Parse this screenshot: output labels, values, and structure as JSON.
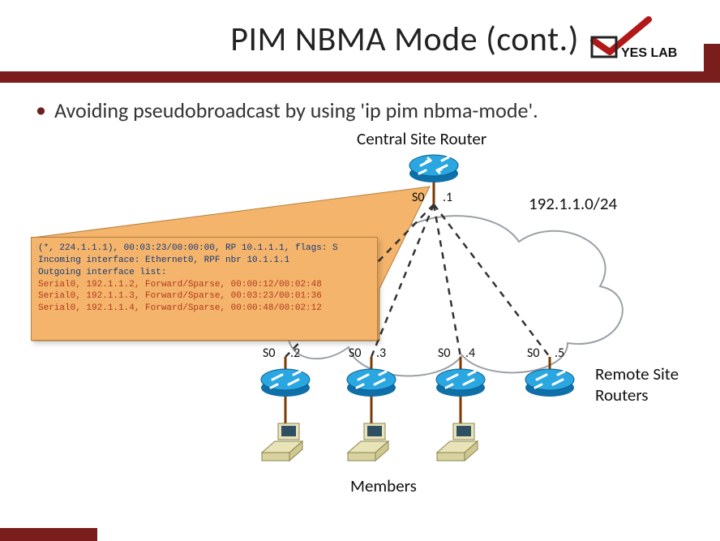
{
  "title": "PIM NBMA Mode (cont.)",
  "logo_text": "YES LAB",
  "bullet_text": "Avoiding pseudobroadcast by using 'ip pim nbma-mode'.",
  "labels": {
    "central_router": "Central Site Router",
    "subnet": "192.1.1.0/24",
    "remote_routers_l1": "Remote Site",
    "remote_routers_l2": "Routers",
    "members": "Members",
    "central_intf": "S0",
    "central_ip": ".1",
    "r2_intf": "S0",
    "r2_ip": ".2",
    "r3_intf": "S0",
    "r3_ip": ".3",
    "r4_intf": "S0",
    "r4_ip": ".4",
    "r5_intf": "S0",
    "r5_ip": ".5"
  },
  "callout": {
    "line1": "(*, 224.1.1.1), 00:03:23/00:00:00, RP 10.1.1.1, flags: S",
    "line2": "  Incoming interface: Ethernet0, RPF nbr 10.1.1.1",
    "line3": "  Outgoing interface list:",
    "line4": "    Serial0, 192.1.1.2, Forward/Sparse, 00:00:12/00:02:48",
    "line5": "    Serial0, 192.1.1.3, Forward/Sparse, 00:03:23/00:01:36",
    "line6": "    Serial0, 192.1.1.4, Forward/Sparse, 00:00:48/00:02:12"
  }
}
